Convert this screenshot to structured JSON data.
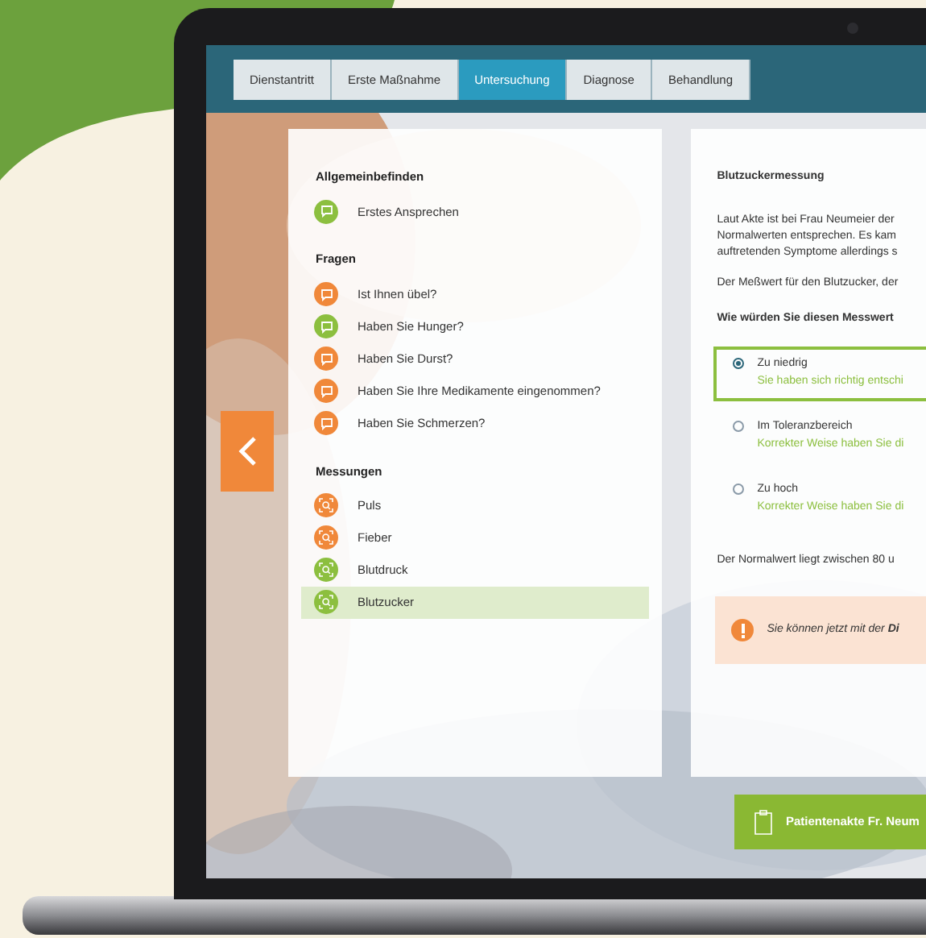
{
  "tabs": [
    {
      "label": "Dienstantritt",
      "selected": false
    },
    {
      "label": "Erste Maßnahme",
      "selected": false
    },
    {
      "label": "Untersuchung",
      "selected": true
    },
    {
      "label": "Diagnose",
      "selected": false
    },
    {
      "label": "Behandlung",
      "selected": false
    }
  ],
  "sidebar": {
    "sections": [
      {
        "title": "Allgemeinbefinden",
        "kind": "chat",
        "items": [
          {
            "label": "Erstes Ansprechen",
            "color": "#8cbf3f",
            "selected": false
          }
        ]
      },
      {
        "title": "Fragen",
        "kind": "chat",
        "items": [
          {
            "label": "Ist Ihnen übel?",
            "color": "#f0883a",
            "selected": false
          },
          {
            "label": "Haben Sie Hunger?",
            "color": "#8cbf3f",
            "selected": false
          },
          {
            "label": "Haben Sie Durst?",
            "color": "#f0883a",
            "selected": false
          },
          {
            "label": "Haben Sie Ihre Medikamente eingenommen?",
            "color": "#f0883a",
            "selected": false
          },
          {
            "label": "Haben Sie Schmerzen?",
            "color": "#f0883a",
            "selected": false
          }
        ]
      },
      {
        "title": "Messungen",
        "kind": "scan",
        "items": [
          {
            "label": "Puls",
            "color": "#f0883a",
            "selected": false
          },
          {
            "label": "Fieber",
            "color": "#f0883a",
            "selected": false
          },
          {
            "label": "Blutdruck",
            "color": "#8cbf3f",
            "selected": false
          },
          {
            "label": "Blutzucker",
            "color": "#8cbf3f",
            "selected": true
          }
        ]
      }
    ]
  },
  "content": {
    "title": "Blutzuckermessung",
    "paragraph_lines": [
      "Laut Akte ist bei Frau Neumeier der",
      "Normalwerten entsprechen. Es kam",
      "auftretenden Symptome allerdings s"
    ],
    "measurement_line": "Der Meßwert für den Blutzucker, der",
    "question": "Wie würden Sie diesen Messwert",
    "options": [
      {
        "label": "Zu niedrig",
        "feedback": "Sie haben sich richtig entschi",
        "selected": true
      },
      {
        "label": "Im Toleranzbereich",
        "feedback": "Korrekter Weise haben Sie di",
        "selected": false
      },
      {
        "label": "Zu hoch",
        "feedback": "Korrekter Weise haben Sie di",
        "selected": false
      }
    ],
    "note": "Der Normalwert liegt zwischen 80 u",
    "alert": "Sie können jetzt mit der **Di**"
  },
  "record_button": "Patientenakte Fr. Neum"
}
